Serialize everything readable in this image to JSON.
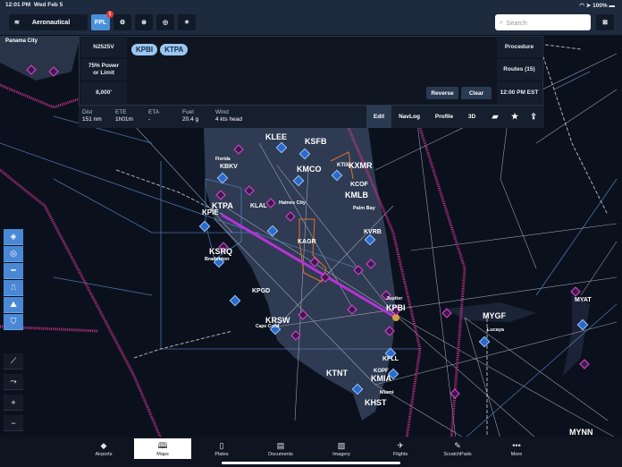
{
  "status_bar": {
    "time": "12:01 PM",
    "date": "Wed Feb 5",
    "battery": "100%"
  },
  "toolbar": {
    "layer_label": "Aeronautical",
    "fpl_label": "FPL",
    "fpl_badge": "1",
    "search_placeholder": "Search"
  },
  "flight_plan": {
    "aircraft": "N2525V",
    "power": "75% Power or Limit",
    "altitude": "8,000'",
    "route": [
      "KPBI",
      "KTPA"
    ],
    "reverse_label": "Reverse",
    "clear_label": "Clear",
    "procedure_label": "Procedure",
    "routes_label": "Routes (15)",
    "departure_time": "12:00 PM EST",
    "info": [
      {
        "k": "Dist",
        "v": "151 nm"
      },
      {
        "k": "ETE",
        "v": "1h01m"
      },
      {
        "k": "ETA",
        "v": "-"
      },
      {
        "k": "Fuel",
        "v": "20.4 g"
      },
      {
        "k": "Wind",
        "v": "4 kts head"
      }
    ],
    "tabs": [
      "Edit",
      "NavLog",
      "Profile",
      "3D"
    ],
    "selected_tab": "Edit"
  },
  "map": {
    "route_color": "#b832d8",
    "labels": [
      {
        "t": "KLEE"
      },
      {
        "t": "KSFB"
      },
      {
        "t": "Florida"
      },
      {
        "t": "KBKV"
      },
      {
        "t": "KMCO"
      },
      {
        "t": "KTIX"
      },
      {
        "t": "KXMR"
      },
      {
        "t": "KCOF"
      },
      {
        "t": "KMLB"
      },
      {
        "t": "KTPA"
      },
      {
        "t": "KPIE"
      },
      {
        "t": "KLAL"
      },
      {
        "t": "Haines City"
      },
      {
        "t": "Palm Bay"
      },
      {
        "t": "KVRB"
      },
      {
        "t": "KAGR"
      },
      {
        "t": "KSRQ"
      },
      {
        "t": "Bradenton"
      },
      {
        "t": "KPGD"
      },
      {
        "t": "Jupiter"
      },
      {
        "t": "KPBI"
      },
      {
        "t": "KRSW"
      },
      {
        "t": "Cape Coral"
      },
      {
        "t": "MYGF"
      },
      {
        "t": "Lucaya"
      },
      {
        "t": "MYAT"
      },
      {
        "t": "KFLL"
      },
      {
        "t": "KOPF"
      },
      {
        "t": "KTNT"
      },
      {
        "t": "KMIA"
      },
      {
        "t": "Miami"
      },
      {
        "t": "KHST"
      },
      {
        "t": "MYNN"
      },
      {
        "t": "Panama City"
      }
    ]
  },
  "bottom_tabs": [
    {
      "label": "Airports",
      "icon": "airport-icon"
    },
    {
      "label": "Maps",
      "icon": "map-icon"
    },
    {
      "label": "Plates",
      "icon": "plates-icon"
    },
    {
      "label": "Documents",
      "icon": "documents-icon"
    },
    {
      "label": "Imagery",
      "icon": "imagery-icon"
    },
    {
      "label": "Flights",
      "icon": "flights-icon"
    },
    {
      "label": "ScratchPads",
      "icon": "pencil-icon"
    },
    {
      "label": "More",
      "icon": "more-icon"
    }
  ],
  "selected_bottom_tab": "Maps"
}
